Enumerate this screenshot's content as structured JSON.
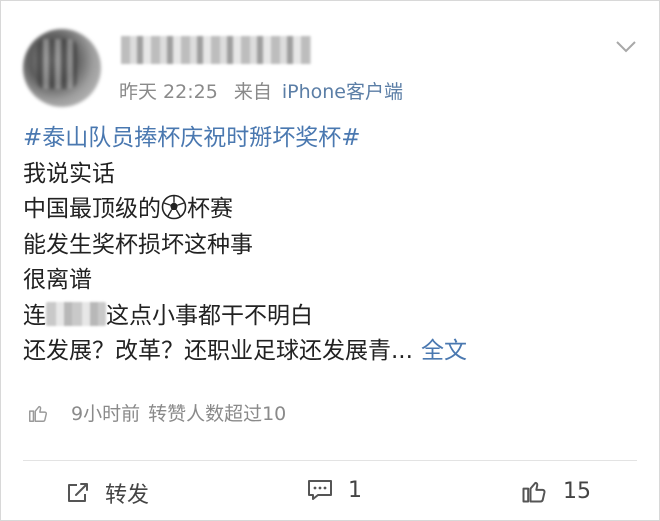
{
  "post": {
    "time": "昨天 22:25",
    "source_prefix": "来自",
    "source": "iPhone客户端",
    "lines": {
      "hashtag": "#泰山队员捧杯庆祝时掰坏奖杯#",
      "l1": "我说实话",
      "l2_a": "中国最顶级的",
      "l2_b": "杯赛",
      "l3": "能发生奖杯损坏这种事",
      "l4": "很离谱",
      "l5_a": "连",
      "l5_b": "这点小事都干不明白",
      "l6": "还发展？改革？还职业足球还发展青...",
      "more": "全文"
    }
  },
  "stats": {
    "time_ago": "9小时前",
    "repost_note": "转赞人数超过10"
  },
  "actions": {
    "repost_label": "转发",
    "comment_count": "1",
    "like_count": "15"
  },
  "icons": [
    "avatar",
    "chevron-down-icon",
    "soccer-ball-icon",
    "thumbs-up-icon",
    "repost-icon",
    "comment-icon"
  ]
}
